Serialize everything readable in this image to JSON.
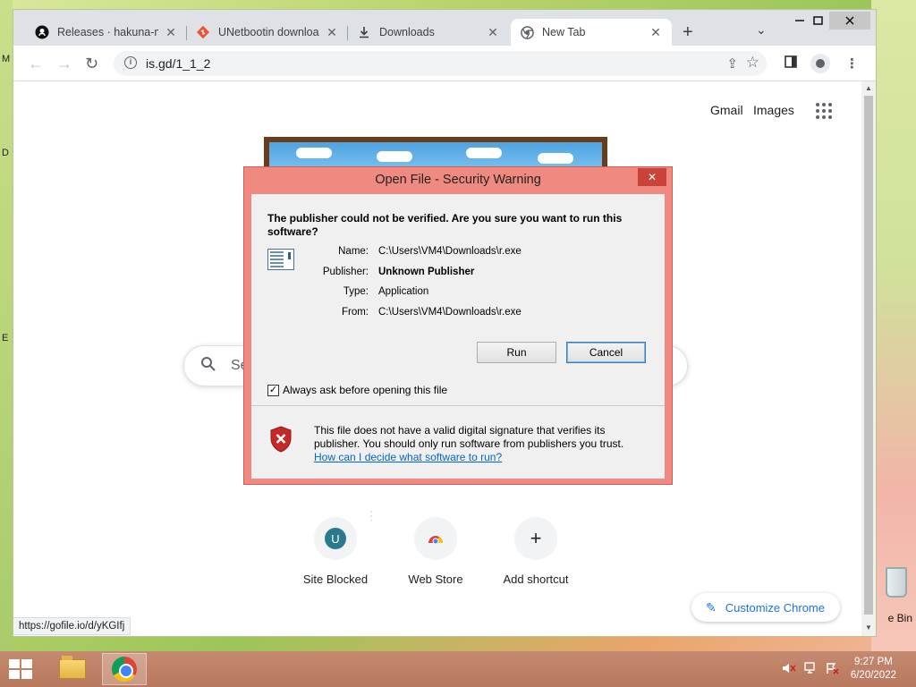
{
  "desktop": {
    "edge_letters": [
      "M",
      "D",
      "E"
    ],
    "recycle_bin_label": "e Bin"
  },
  "browser": {
    "tabs": [
      {
        "title": "Releases · hakuna-m/…",
        "icon": "github-icon"
      },
      {
        "title": "UNetbootin download",
        "icon": "git-diamond-icon"
      },
      {
        "title": "Downloads",
        "icon": "download-icon"
      },
      {
        "title": "New Tab",
        "icon": "chrome-icon",
        "active": true
      }
    ],
    "address": "is.gd/1_1_2",
    "top_links": {
      "gmail": "Gmail",
      "images": "Images"
    },
    "search_placeholder": "Se",
    "shortcuts": [
      {
        "label": "Site Blocked",
        "letter": "U",
        "color": "#2a7a8c"
      },
      {
        "label": "Web Store",
        "icon": "webstore-icon"
      },
      {
        "label": "Add shortcut",
        "icon": "plus-icon"
      }
    ],
    "customize_label": "Customize Chrome",
    "status_url": "https://gofile.io/d/yKGIfj"
  },
  "dialog": {
    "title": "Open File - Security Warning",
    "heading": "The publisher could not be verified.  Are you sure you want to run this software?",
    "fields": [
      {
        "label": "Name:",
        "value": "C:\\Users\\VM4\\Downloads\\r.exe",
        "bold": false
      },
      {
        "label": "Publisher:",
        "value": "Unknown Publisher",
        "bold": true
      },
      {
        "label": "Type:",
        "value": "Application",
        "bold": false
      },
      {
        "label": "From:",
        "value": "C:\\Users\\VM4\\Downloads\\r.exe",
        "bold": false
      }
    ],
    "run_label": "Run",
    "cancel_label": "Cancel",
    "checkbox_label": "Always ask before opening this file",
    "checkbox_checked": true,
    "warning_text": "This file does not have a valid digital signature that verifies its publisher.  You should only run software from publishers you trust.",
    "help_link": "How can I decide what software to run?"
  },
  "taskbar": {
    "time": "9:27 PM",
    "date": "6/20/2022"
  },
  "colors": {
    "dialog_frame": "#f08a80",
    "link_blue": "#1a73e8",
    "taskbar": "#b8785d"
  }
}
